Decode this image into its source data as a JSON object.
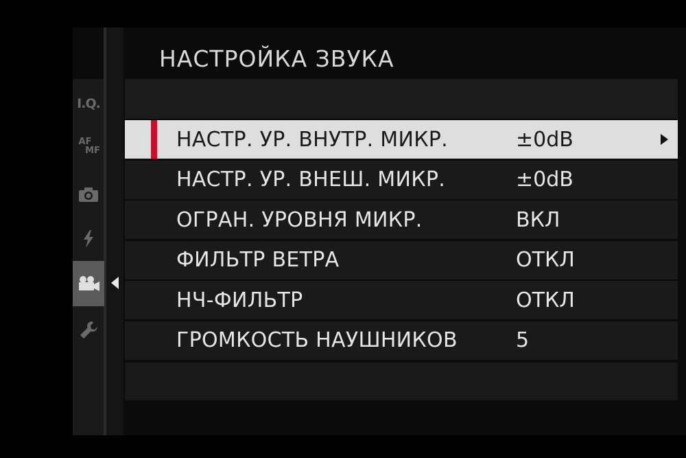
{
  "header": {
    "title": "НАСТРОЙКА ЗВУКА"
  },
  "tabs": [
    {
      "id": "iq",
      "label": "I.Q."
    },
    {
      "id": "af-mf",
      "label_top": "AF",
      "label_bottom": "MF"
    },
    {
      "id": "camera",
      "icon": "camera-icon"
    },
    {
      "id": "flash",
      "icon": "flash-icon"
    },
    {
      "id": "movie",
      "icon": "movie-camera-icon",
      "active": true
    },
    {
      "id": "setup",
      "icon": "wrench-icon"
    }
  ],
  "menu": {
    "items": [
      {
        "label": "НАСТР. УР. ВНУТР. МИКР.",
        "value": "±0dB",
        "selected": true
      },
      {
        "label": "НАСТР. УР. ВНЕШ. МИКР.",
        "value": "±0dB"
      },
      {
        "label": "ОГРАН. УРОВНЯ МИКР.",
        "value": "ВКЛ"
      },
      {
        "label": "ФИЛЬТР ВЕТРА",
        "value": "ОТКЛ"
      },
      {
        "label": "НЧ-ФИЛЬТР",
        "value": "ОТКЛ"
      },
      {
        "label": "ГРОМКОСТЬ НАУШНИКОВ",
        "value": "5"
      }
    ]
  },
  "colors": {
    "accent": "#c8102e",
    "selected_bg": "#dedede",
    "row_bg": "#1a1a1a",
    "text": "#e6e6e6"
  }
}
